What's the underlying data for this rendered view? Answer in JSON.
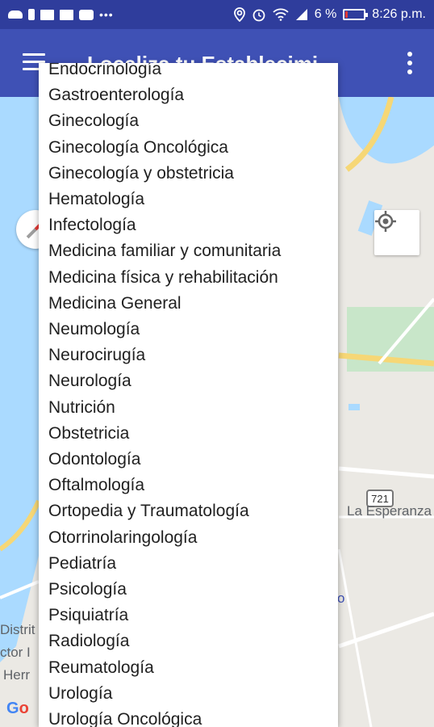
{
  "status_bar": {
    "battery_percent": "6 %",
    "time": "8:26 p.m.",
    "left_icons": [
      "cloud-icon",
      "battery-saver-icon",
      "mail-icon",
      "calendar-icon",
      "youtube-icon",
      "more-notifications-icon"
    ],
    "right_icons": [
      "location-icon",
      "alarm-icon",
      "wifi-icon",
      "signal-icon",
      "battery-icon"
    ],
    "battery_level": 0.06,
    "battery_color": "#e53935"
  },
  "app_bar": {
    "title": "Localiza tu Establecimi...",
    "menu_icon": "hamburger-menu-icon",
    "overflow_icon": "overflow-menu-icon",
    "background_color": "#3f51b5",
    "status_color": "#2f3d9c"
  },
  "map": {
    "labels": {
      "la_esperanza": "La Esperanza",
      "road_721": "721",
      "distrit": "Distrit",
      "ctor": "ctor I",
      "herr": "Herr",
      "o": "o"
    },
    "google_logo": {
      "g": "G",
      "o": "o"
    },
    "locate_icon": "my-location-icon",
    "compass_icon": "compass-icon",
    "water_color": "#aadaff",
    "road_color": "#f6d776"
  },
  "dropdown": {
    "items": [
      "Endocrinología",
      "Gastroenterología",
      "Ginecología",
      "Ginecología Oncológica",
      "Ginecología y obstetricia",
      "Hematología",
      "Infectología",
      "Medicina familiar y comunitaria",
      "Medicina física y rehabilitación",
      "Medicina General",
      "Neumología",
      "Neurocirugía",
      "Neurología",
      "Nutrición",
      "Obstetricia",
      "Odontología",
      "Oftalmología",
      "Ortopedia y Traumatología",
      "Otorrinolaringología",
      "Pediatría",
      "Psicología",
      "Psiquiatría",
      "Radiología",
      "Reumatología",
      "Urología",
      "Urología Oncológica"
    ]
  }
}
